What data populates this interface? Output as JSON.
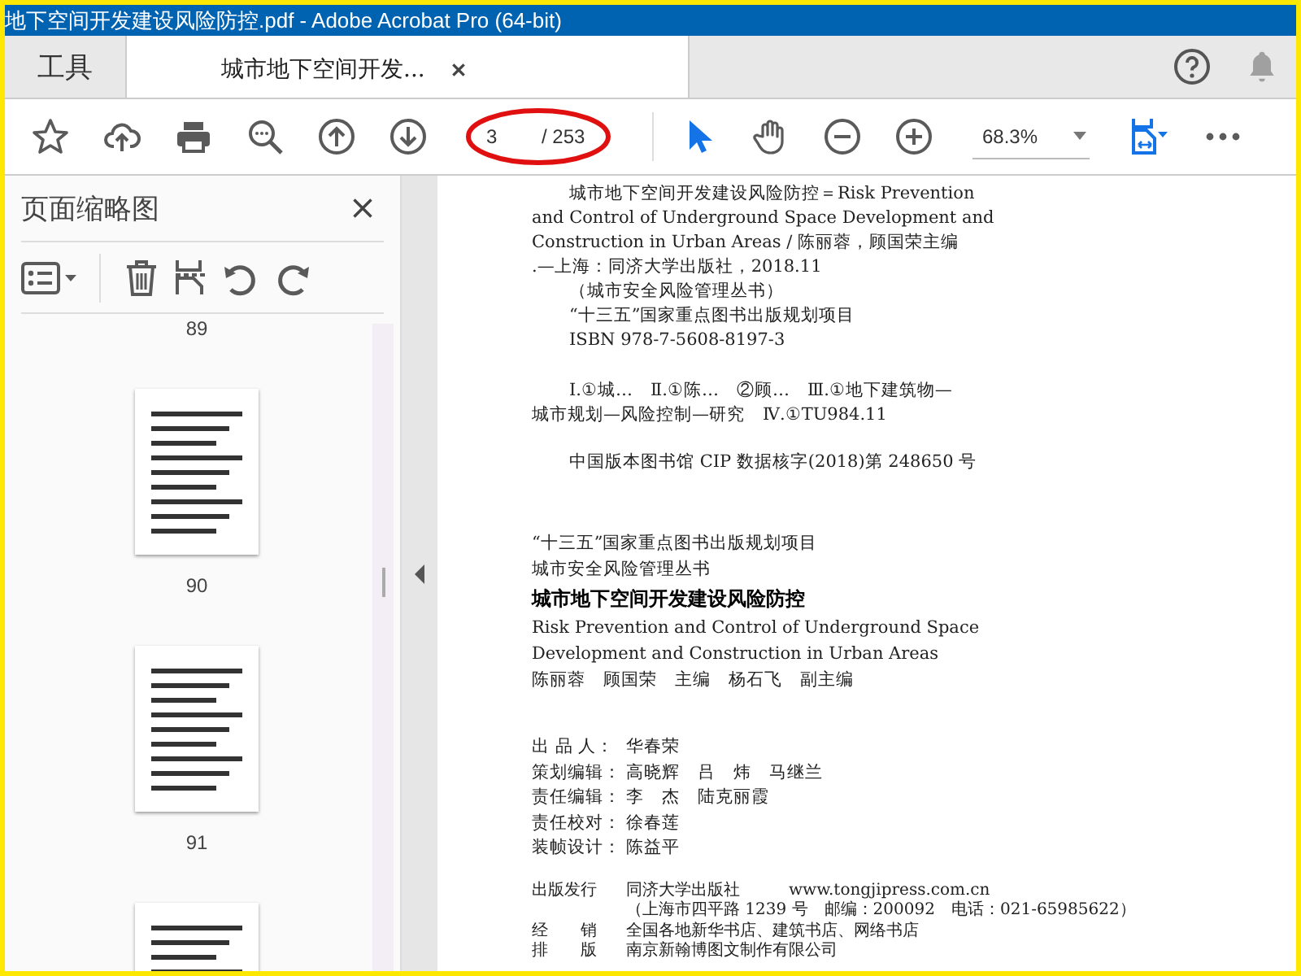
{
  "window": {
    "title": "地下空间开发建设风险防控.pdf - Adobe Acrobat Pro (64-bit)"
  },
  "tabs": [
    {
      "label": "工具",
      "selected": false
    },
    {
      "label": "城市地下空间开发...",
      "selected": true
    }
  ],
  "toolbar": {
    "tools_left": [
      {
        "kind": "star"
      },
      {
        "kind": "upload"
      },
      {
        "kind": "print"
      },
      {
        "kind": "find"
      },
      {
        "kind": "prev-page"
      },
      {
        "kind": "next-page"
      }
    ],
    "page": {
      "current": "3",
      "total": "/ 253",
      "circled": true
    },
    "tools_right": [
      {
        "kind": "select",
        "selected": true
      },
      {
        "kind": "hand",
        "selected": false
      },
      {
        "kind": "zoom-out"
      },
      {
        "kind": "zoom-in"
      }
    ],
    "zoom": {
      "value": "68.3%"
    },
    "view_tools": [
      {
        "kind": "fit-page"
      },
      {
        "kind": "more"
      }
    ]
  },
  "thumbnails_panel": {
    "title": "页面缩略图",
    "pages": [
      "89",
      "90",
      "91"
    ]
  },
  "document": {
    "sections": [
      {
        "kind": "cip",
        "lines": [
          {
            "kind": "indent",
            "text": "城市地下空间开发建设风险防控＝Risk Prevention"
          },
          {
            "kind": "flush",
            "text": "and Control of Underground Space Development and"
          },
          {
            "kind": "flush",
            "text": "Construction in Urban Areas / 陈丽蓉，顾国荣主编"
          },
          {
            "kind": "flush",
            "text": ".—上海：同济大学出版社，2018.11"
          },
          {
            "kind": "indent",
            "text": "（城市安全风险管理丛书）"
          },
          {
            "kind": "indent",
            "text": "“十三五”国家重点图书出版规划项目"
          },
          {
            "kind": "indent",
            "text": "ISBN 978-7-5608-8197-3"
          }
        ]
      },
      {
        "kind": "cip-class",
        "lines": [
          {
            "kind": "indent",
            "text": "Ⅰ.①城…　Ⅱ.①陈…　②顾…　Ⅲ.①地下建筑物—"
          },
          {
            "kind": "flush",
            "text": "城市规划—风险控制—研究　Ⅳ.①TU984.11"
          }
        ]
      },
      {
        "kind": "cip-number",
        "lines": [
          {
            "kind": "indent",
            "text": "中国版本图书馆 CIP 数据核字(2018)第 248650 号"
          }
        ]
      },
      {
        "kind": "series",
        "lines": [
          {
            "kind": "flush",
            "text": "“十三五”国家重点图书出版规划项目"
          },
          {
            "kind": "flush",
            "text": "城市安全风险管理丛书"
          },
          {
            "kind": "title",
            "text": "城市地下空间开发建设风险防控"
          },
          {
            "kind": "flush",
            "text": "Risk Prevention and Control of Underground Space"
          },
          {
            "kind": "flush",
            "text": "Development and Construction in Urban Areas"
          },
          {
            "kind": "flush",
            "text": "陈丽蓉　顾国荣　主编　杨石飞　副主编"
          }
        ]
      },
      {
        "kind": "credits",
        "rows": [
          {
            "label": "出 品 人：",
            "value": "华春荣"
          },
          {
            "label": "策划编辑：",
            "value": "高晓辉　吕　炜　马继兰"
          },
          {
            "label": "责任编辑：",
            "value": "李　杰　陆克丽霞"
          },
          {
            "label": "责任校对：",
            "value": "徐春莲"
          },
          {
            "label": "装帧设计：",
            "value": "陈益平"
          }
        ]
      },
      {
        "kind": "publisher",
        "rows": [
          {
            "label": "出版发行",
            "value": "同济大学出版社　　　www.tongjipress.com.cn"
          },
          {
            "value": "（上海市四平路 1239 号　邮编：200092　电话：021-65985622）"
          },
          {
            "label": "经　　销",
            "value": "全国各地新华书店、建筑书店、网络书店"
          },
          {
            "label": "排　　版",
            "value": "南京新翰博图文制作有限公司"
          }
        ]
      }
    ]
  }
}
